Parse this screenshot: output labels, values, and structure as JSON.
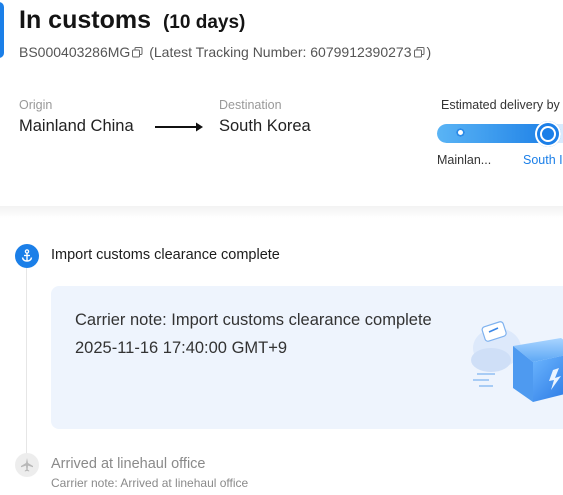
{
  "status": {
    "title": "In customs",
    "duration": "(10 days)"
  },
  "tracking": {
    "order_number": "BS000403286MG",
    "latest_prefix": "(Latest Tracking Number: ",
    "latest_number": "6079912390273",
    "latest_suffix": ")"
  },
  "route": {
    "origin_label": "Origin",
    "origin_value": "Mainland China",
    "destination_label": "Destination",
    "destination_value": "South Korea"
  },
  "estimate": {
    "label": "Estimated delivery by",
    "start_label": "Mainlan...",
    "end_label": "South I",
    "progress_percent": 85
  },
  "colors": {
    "accent": "#1b7fe8",
    "card_bg": "#eef4fd",
    "muted": "#8a8a8a"
  },
  "events": [
    {
      "title": "Import customs clearance complete",
      "icon": "anchor-icon",
      "note": "Carrier note: Import customs clearance complete",
      "time": "2025-11-16 17:40:00 GMT+9"
    },
    {
      "title": "Arrived at linehaul office",
      "icon": "plane-icon",
      "note": "Carrier note: Arrived at linehaul office"
    }
  ]
}
